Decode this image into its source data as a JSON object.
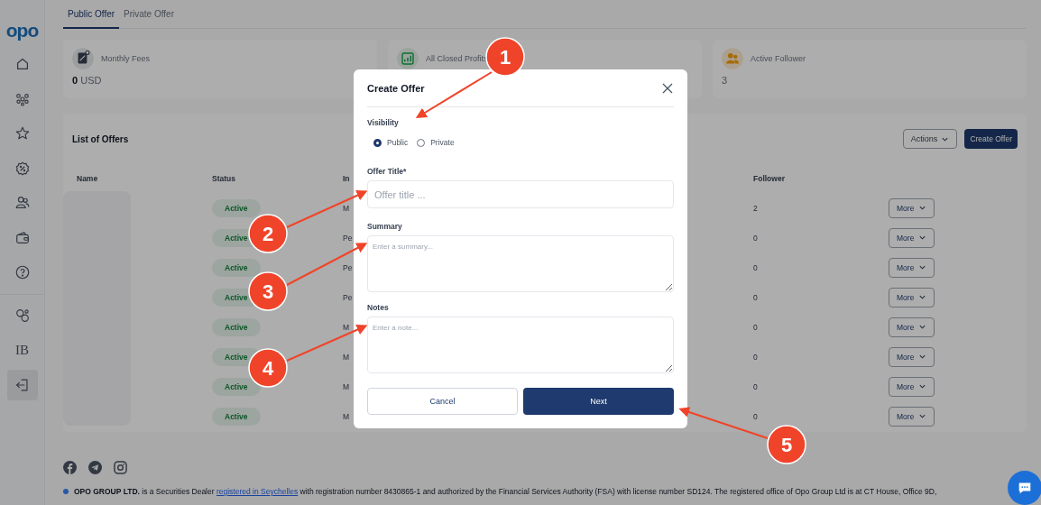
{
  "sidebar": {
    "logo": "opo",
    "items": [
      {
        "kind": "icon",
        "selected": false
      },
      {
        "kind": "icon",
        "selected": false
      },
      {
        "kind": "icon",
        "selected": false
      },
      {
        "kind": "icon",
        "selected": false
      },
      {
        "kind": "icon",
        "selected": false
      },
      {
        "kind": "icon",
        "selected": false
      },
      {
        "kind": "icon",
        "selected": false
      },
      {
        "kind": "icon",
        "selected": false
      },
      {
        "kind": "text",
        "label": "IB",
        "selected": false
      },
      {
        "kind": "icon",
        "selected": true
      }
    ]
  },
  "tabs": [
    {
      "label": "Public Offer",
      "selected": true
    },
    {
      "label": "Private Offer",
      "selected": false
    }
  ],
  "stat_cards": [
    {
      "label": "Monthly Fees",
      "value": "**0** USD"
    },
    {
      "label": "All Closed Profits"
    },
    {
      "label": "Active Follower",
      "value": "3"
    }
  ],
  "offers": {
    "title": "List of Offers",
    "actions_button": "Actions",
    "create_button": "Create Offer",
    "columns": [
      "Name",
      "Status",
      "In",
      "Follower"
    ],
    "rows": [
      {
        "status": "Active",
        "column_3": "M",
        "follower": "2",
        "action": "More"
      },
      {
        "status": "Active",
        "column_3": "Pe",
        "follower": "0",
        "action": "More"
      },
      {
        "status": "Active",
        "column_3": "Pe",
        "follower": "0",
        "action": "More"
      },
      {
        "status": "Active",
        "column_3": "Pe",
        "follower": "0",
        "action": "More"
      },
      {
        "status": "Active",
        "column_3": "M",
        "follower": "0",
        "action": "More"
      },
      {
        "status": "Active",
        "column_3": "M",
        "follower": "0",
        "action": "More"
      },
      {
        "status": "Active",
        "column_3": "M",
        "follower": "0",
        "action": "More"
      },
      {
        "status": "Active",
        "column_3": "M",
        "follower": "0",
        "action": "More"
      }
    ]
  },
  "footer": {
    "notice_start": "**OPO GROUP LTD.** is a Securities Dealer",
    "notice_link": "registered in Seychelles",
    "notice_end": "with registration number 8430865-1 and authorized by the Financial Services Authority (FSA) with license number SD124. The registered office of Opo Group Ltd is at CT House, Office 9D,"
  },
  "dialog": {
    "title": "Create Offer",
    "visibility_label": "Visibility",
    "visibility_options": [
      {
        "label": "Public",
        "selected": true
      },
      {
        "label": "Private",
        "selected": false
      }
    ],
    "title_label": "Offer Title*",
    "title_placeholder": "Offer title ...",
    "summary_label": "Summary",
    "summary_placeholder": "Enter a summary...",
    "notes_label": "Notes",
    "notes_placeholder": "Enter a note...",
    "cancel": "Cancel",
    "next": "Next"
  },
  "annotations": [
    {
      "number": "1"
    },
    {
      "number": "2"
    },
    {
      "number": "3"
    },
    {
      "number": "4"
    },
    {
      "number": "5"
    }
  ]
}
